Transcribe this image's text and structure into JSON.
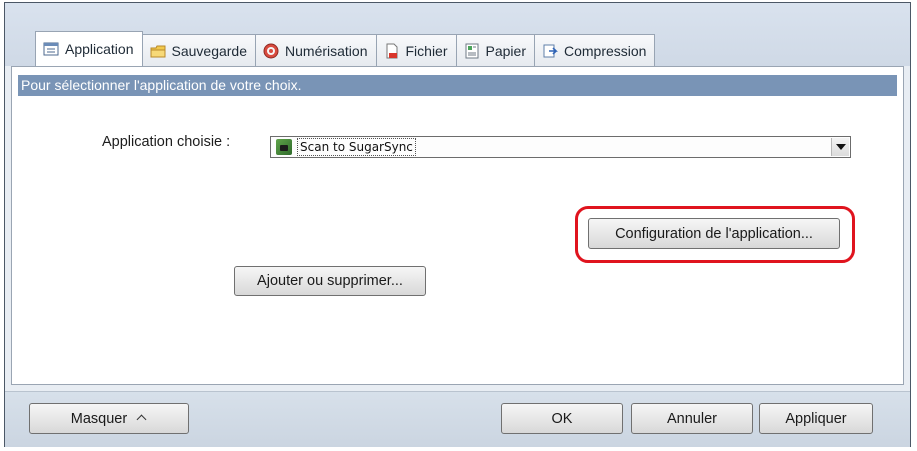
{
  "tabs": [
    {
      "label": "Application",
      "icon": "application-icon",
      "active": true
    },
    {
      "label": "Sauvegarde",
      "icon": "folder-icon",
      "active": false
    },
    {
      "label": "Numérisation",
      "icon": "scan-icon",
      "active": false
    },
    {
      "label": "Fichier",
      "icon": "file-icon",
      "active": false
    },
    {
      "label": "Papier",
      "icon": "paper-icon",
      "active": false
    },
    {
      "label": "Compression",
      "icon": "compression-icon",
      "active": false
    }
  ],
  "panel": {
    "description": "Pour sélectionner l'application de votre choix.",
    "app_label": "Application choisie :",
    "selected_app": "Scan to SugarSync",
    "selected_app_icon": "sugarsync-icon",
    "config_button": "Configuration de l'application...",
    "add_remove_button": "Ajouter ou supprimer..."
  },
  "footer": {
    "hide_button": "Masquer",
    "ok_button": "OK",
    "cancel_button": "Annuler",
    "apply_button": "Appliquer"
  },
  "colors": {
    "description_bar": "#7994b6",
    "highlight": "#e0141e"
  }
}
